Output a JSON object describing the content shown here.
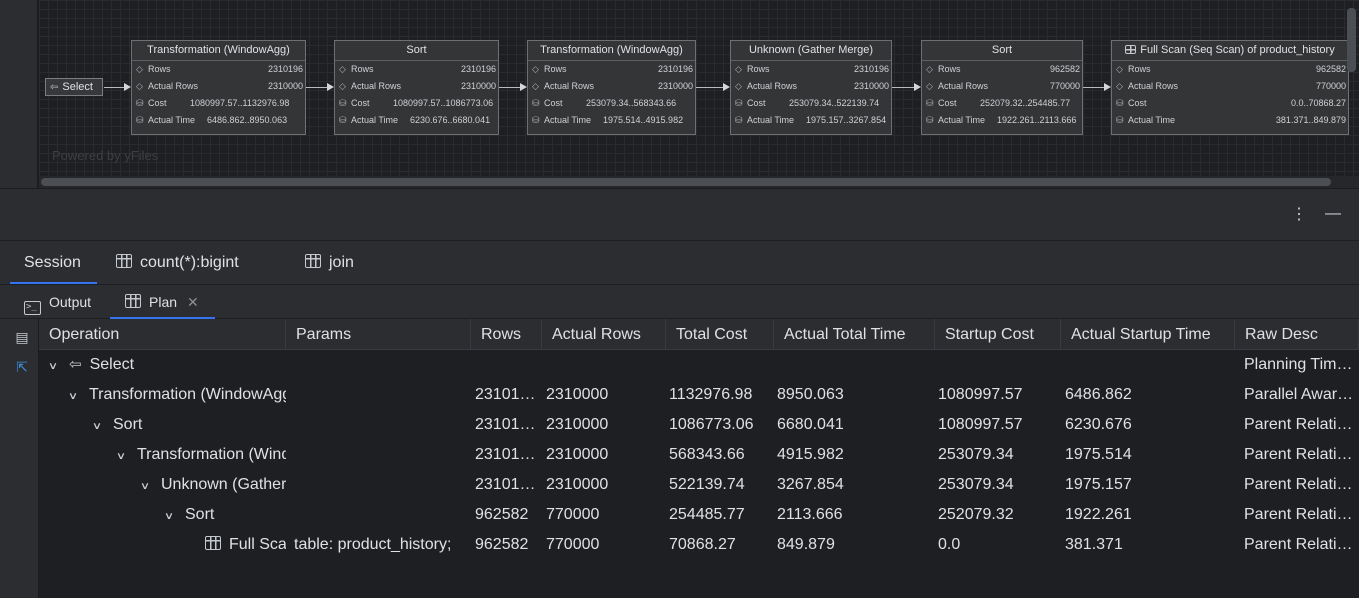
{
  "diagram": {
    "select_label": "Select",
    "watermark": "Powered by yFiles",
    "nodes": [
      {
        "title": "Transformation (WindowAgg)",
        "rows_label": "Rows",
        "rows": "2310196",
        "actual_rows_label": "Actual Rows",
        "actual_rows": "2310000",
        "cost_label": "Cost",
        "cost": "1080997.57..1132976.98",
        "actual_time_label": "Actual Time",
        "actual_time": "6486.862..8950.063"
      },
      {
        "title": "Sort",
        "rows_label": "Rows",
        "rows": "2310196",
        "actual_rows_label": "Actual Rows",
        "actual_rows": "2310000",
        "cost_label": "Cost",
        "cost": "1080997.57..1086773.06",
        "actual_time_label": "Actual Time",
        "actual_time": "6230.676..6680.041"
      },
      {
        "title": "Transformation (WindowAgg)",
        "rows_label": "Rows",
        "rows": "2310196",
        "actual_rows_label": "Actual Rows",
        "actual_rows": "2310000",
        "cost_label": "Cost",
        "cost": "253079.34..568343.66",
        "actual_time_label": "Actual Time",
        "actual_time": "1975.514..4915.982"
      },
      {
        "title": "Unknown (Gather Merge)",
        "rows_label": "Rows",
        "rows": "2310196",
        "actual_rows_label": "Actual Rows",
        "actual_rows": "2310000",
        "cost_label": "Cost",
        "cost": "253079.34..522139.74",
        "actual_time_label": "Actual Time",
        "actual_time": "1975.157..3267.854"
      },
      {
        "title": "Sort",
        "rows_label": "Rows",
        "rows": "962582",
        "actual_rows_label": "Actual Rows",
        "actual_rows": "770000",
        "cost_label": "Cost",
        "cost": "252079.32..254485.77",
        "actual_time_label": "Actual Time",
        "actual_time": "1922.261..2113.666"
      },
      {
        "title": "Full Scan (Seq Scan) of product_history",
        "rows_label": "Rows",
        "rows": "962582",
        "actual_rows_label": "Actual Rows",
        "actual_rows": "770000",
        "cost_label": "Cost",
        "cost": "0.0..70868.27",
        "actual_time_label": "Actual Time",
        "actual_time": "381.371..849.879"
      }
    ]
  },
  "session_tabs": [
    {
      "label": "Session",
      "active": true
    },
    {
      "label": "count(*):bigint",
      "icon": "table-icon"
    },
    {
      "label": "join",
      "icon": "table-icon"
    }
  ],
  "sub_tabs": [
    {
      "label": "Output",
      "icon": "terminal-icon"
    },
    {
      "label": "Plan",
      "icon": "table-icon",
      "active": true,
      "closable": true
    }
  ],
  "plan": {
    "columns": [
      "Operation",
      "Params",
      "Rows",
      "Actual Rows",
      "Total Cost",
      "Actual Total Time",
      "Startup Cost",
      "Actual Startup Time",
      "Raw Desc"
    ],
    "rows": [
      {
        "operation": "Select",
        "params": "",
        "rows": "",
        "actual_rows": "",
        "total_cost": "",
        "actual_total_time": "",
        "startup_cost": "",
        "actual_startup_time": "",
        "raw_desc": "Planning Tim…"
      },
      {
        "operation": "Transformation (WindowAgg)",
        "params": "",
        "rows": "23101…",
        "actual_rows": "2310000",
        "total_cost": "1132976.98",
        "actual_total_time": "8950.063",
        "startup_cost": "1080997.57",
        "actual_startup_time": "6486.862",
        "raw_desc": "Parallel Awar…"
      },
      {
        "operation": "Sort",
        "params": "",
        "rows": "23101…",
        "actual_rows": "2310000",
        "total_cost": "1086773.06",
        "actual_total_time": "6680.041",
        "startup_cost": "1080997.57",
        "actual_startup_time": "6230.676",
        "raw_desc": "Parent Relati…"
      },
      {
        "operation": "Transformation (WindowAgg)",
        "params": "",
        "rows": "23101…",
        "actual_rows": "2310000",
        "total_cost": "568343.66",
        "actual_total_time": "4915.982",
        "startup_cost": "253079.34",
        "actual_startup_time": "1975.514",
        "raw_desc": "Parent Relati…"
      },
      {
        "operation": "Unknown (Gather Merge)",
        "params": "",
        "rows": "23101…",
        "actual_rows": "2310000",
        "total_cost": "522139.74",
        "actual_total_time": "3267.854",
        "startup_cost": "253079.34",
        "actual_startup_time": "1975.157",
        "raw_desc": "Parent Relati…"
      },
      {
        "operation": "Sort",
        "params": "",
        "rows": "962582",
        "actual_rows": "770000",
        "total_cost": "254485.77",
        "actual_total_time": "2113.666",
        "startup_cost": "252079.32",
        "actual_startup_time": "1922.261",
        "raw_desc": "Parent Relati…"
      },
      {
        "operation": "Full Scan (Seq Scan) of product_history",
        "params": "table: product_history;",
        "rows": "962582",
        "actual_rows": "770000",
        "total_cost": "70868.27",
        "actual_total_time": "849.879",
        "startup_cost": "0.0",
        "actual_startup_time": "381.371",
        "raw_desc": "Parent Relati…"
      }
    ]
  }
}
